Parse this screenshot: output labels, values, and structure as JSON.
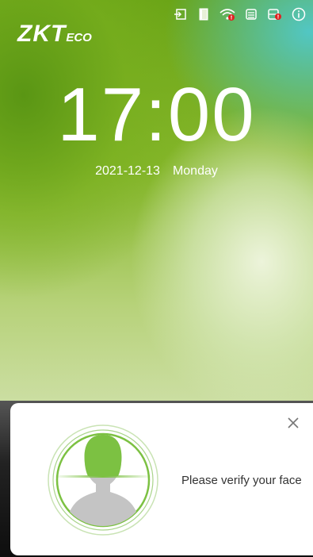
{
  "brand": {
    "logo_main": "ZKT",
    "logo_sub": "eco"
  },
  "status_bar": {
    "icons": [
      "login-icon",
      "door-icon",
      "wifi-icon",
      "printer-icon",
      "database-icon",
      "info-icon"
    ],
    "alert_color": "#e02020"
  },
  "clock": {
    "time": "17:00",
    "date": "2021-12-13",
    "weekday": "Monday"
  },
  "verify_prompt": {
    "message": "Please verify your face",
    "accent_color": "#7cc142"
  }
}
